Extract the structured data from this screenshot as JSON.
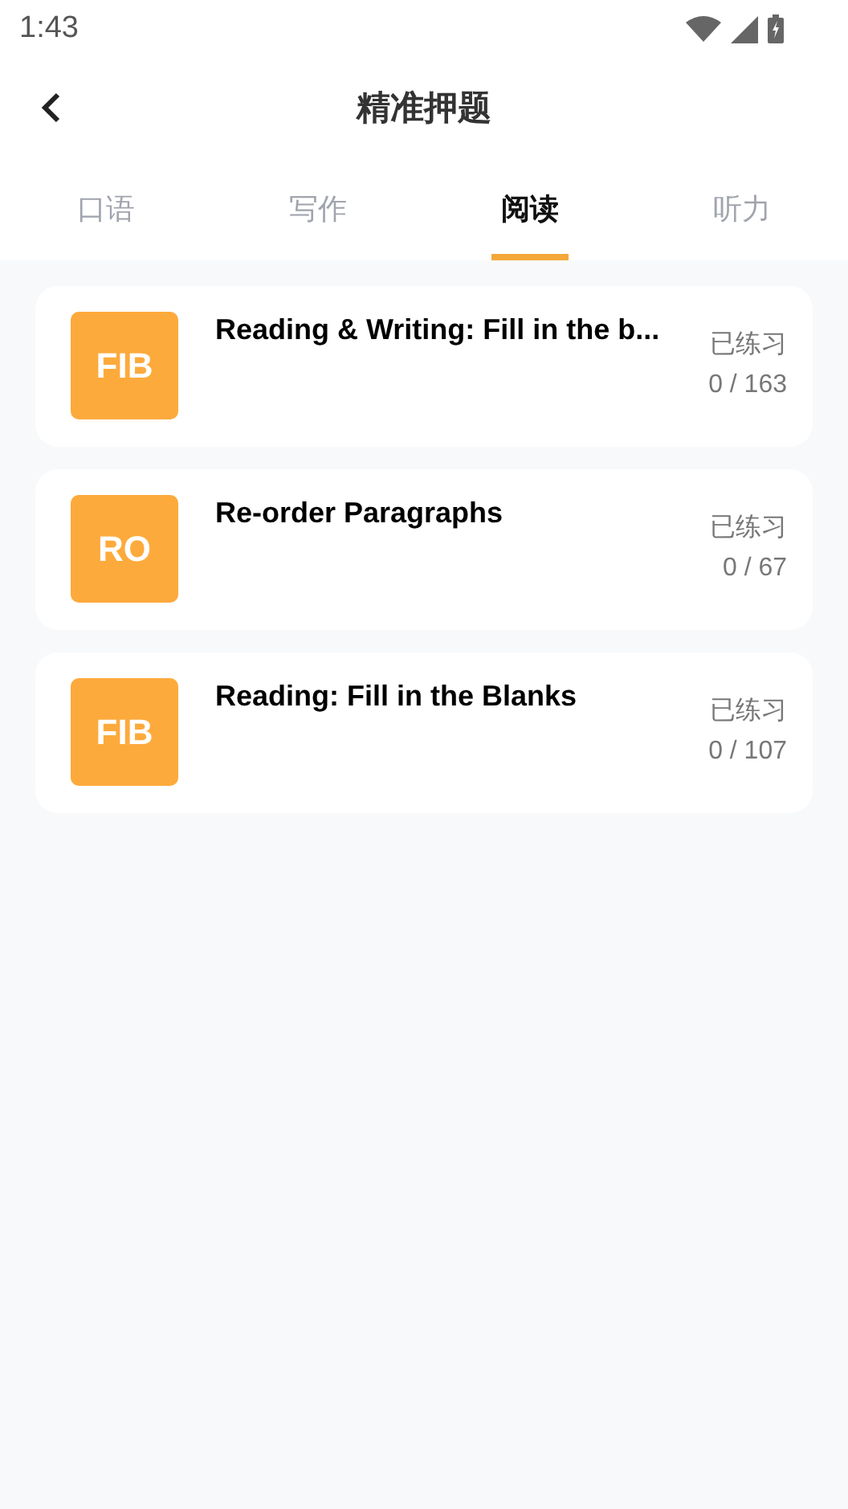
{
  "status_bar": {
    "time": "1:43"
  },
  "header": {
    "title": "精准押题"
  },
  "tabs": [
    {
      "label": "口语",
      "selected": false
    },
    {
      "label": "写作",
      "selected": false
    },
    {
      "label": "阅读",
      "selected": true
    },
    {
      "label": "听力",
      "selected": false
    }
  ],
  "items": [
    {
      "badge": "FIB",
      "title": "Reading & Writing: Fill in the b...",
      "status": "已练习",
      "progress": "0 / 163"
    },
    {
      "badge": "RO",
      "title": "Re-order Paragraphs",
      "status": "已练习",
      "progress": "0 / 67"
    },
    {
      "badge": "FIB",
      "title": "Reading: Fill in the Blanks",
      "status": "已练习",
      "progress": "0 / 107"
    }
  ]
}
